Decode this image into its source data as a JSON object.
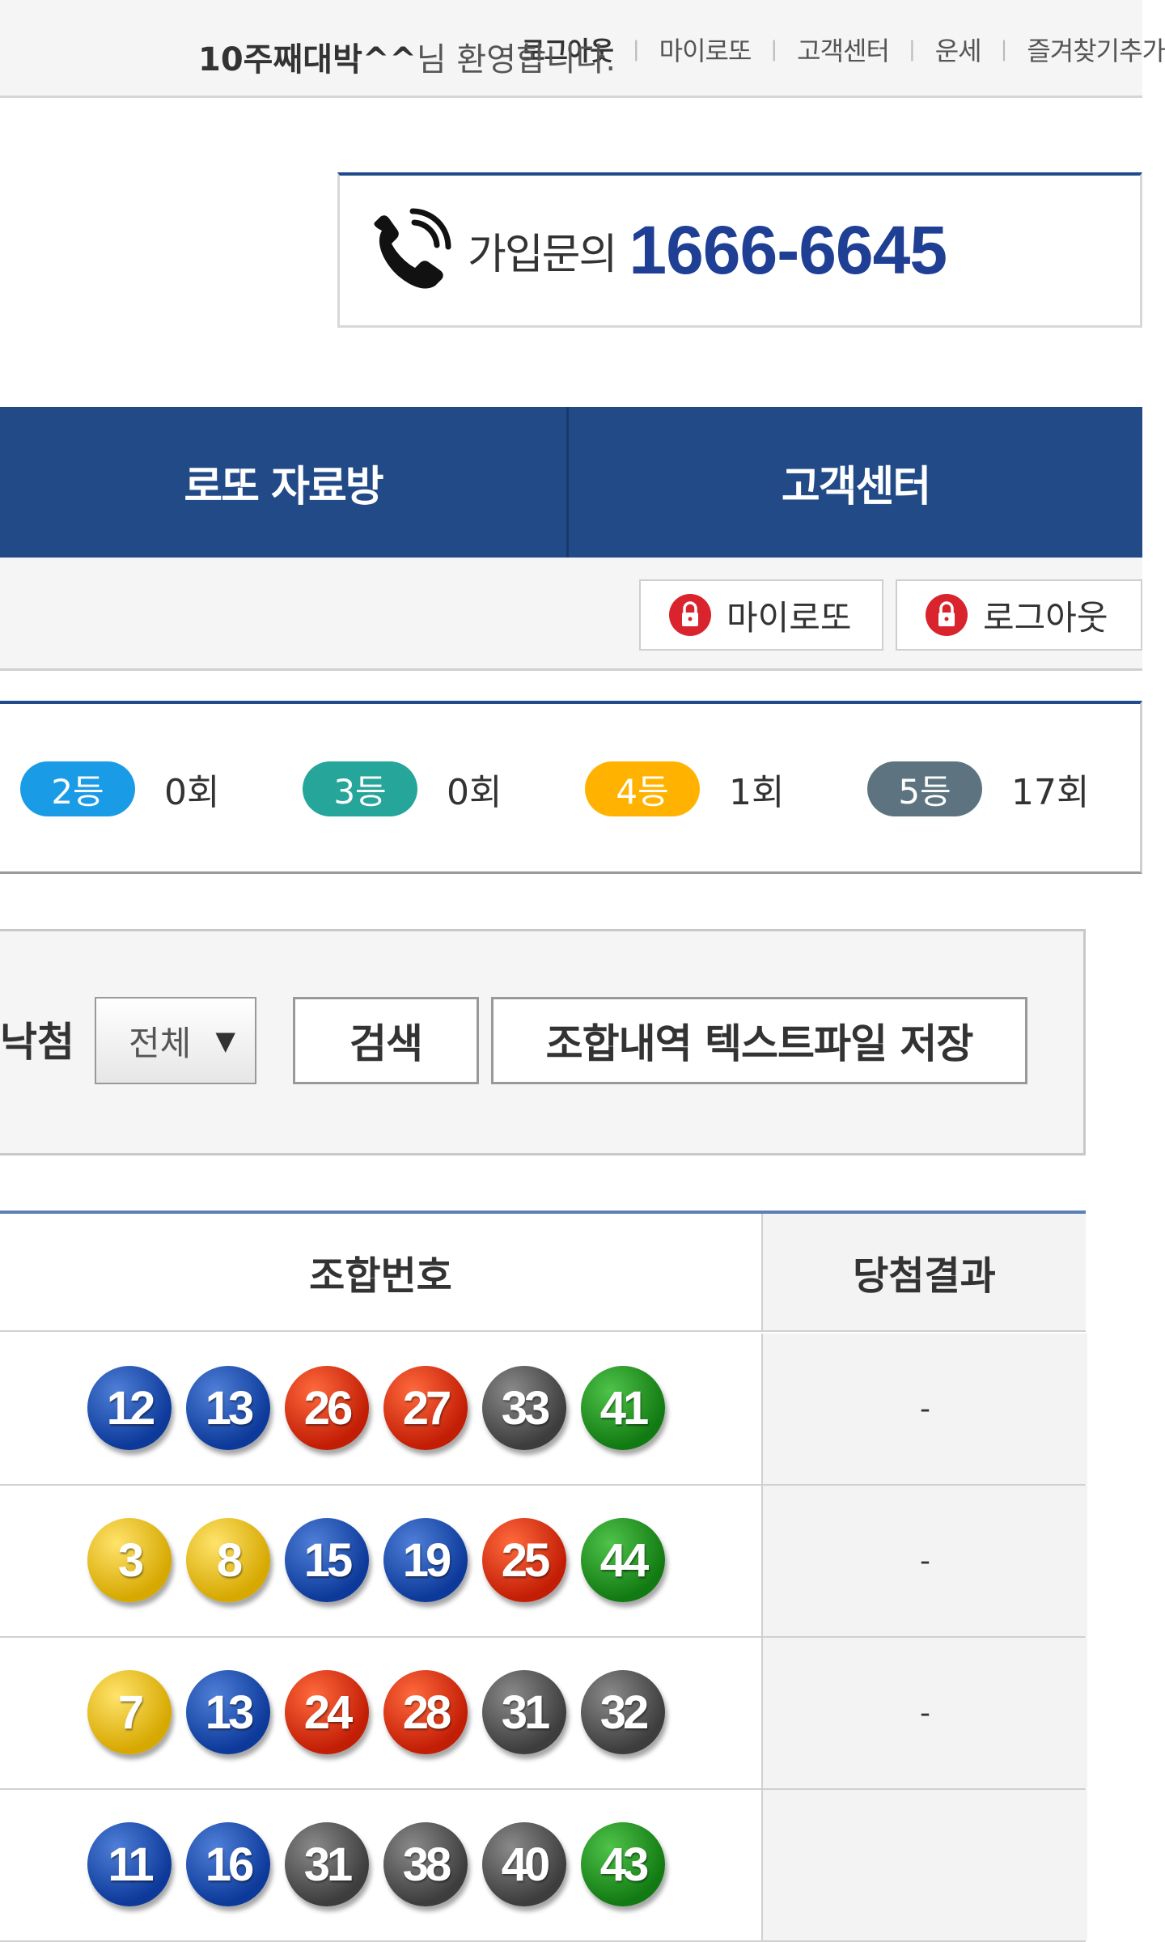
{
  "top_links": [
    "로그아웃",
    "마이로또",
    "고객센터",
    "운세",
    "즐겨찾기추가"
  ],
  "phone": {
    "label": "가입문의",
    "number": "1666-6645",
    "icon": "phone-icon"
  },
  "nav": [
    "로또 자료방",
    "고객센터"
  ],
  "welcome": {
    "user": "10주째대박^^",
    "suffix": "님 환영합니다.",
    "mylotto_button": "마이로또",
    "logout_button": "로그아웃",
    "icon": "lock-icon"
  },
  "ranks": [
    {
      "label": "2등",
      "count": "0회",
      "color": "#1a9be6"
    },
    {
      "label": "3등",
      "count": "0회",
      "color": "#26a59a"
    },
    {
      "label": "4등",
      "count": "1회",
      "color": "#ffb300"
    },
    {
      "label": "5등",
      "count": "17회",
      "color": "#5d7480"
    }
  ],
  "search": {
    "label": "낙첨",
    "select_value": "전체",
    "search_button": "검색",
    "save_button": "조합내역 텍스트파일 저장"
  },
  "table": {
    "headers": [
      "조합번호",
      "당첨결과"
    ],
    "rows": [
      {
        "balls": [
          12,
          13,
          26,
          27,
          33,
          41
        ],
        "result": "-"
      },
      {
        "balls": [
          3,
          8,
          15,
          19,
          25,
          44
        ],
        "result": "-"
      },
      {
        "balls": [
          7,
          13,
          24,
          28,
          31,
          32
        ],
        "result": "-"
      },
      {
        "balls": [
          11,
          16,
          31,
          38,
          40,
          43
        ],
        "result": ""
      }
    ]
  },
  "ball_colors": {
    "1-10": "#e0b000",
    "11-20": "#1a4aa8",
    "21-30": "#d32a0a",
    "31-40": "#555555",
    "41-45": "#1f8a1f"
  }
}
